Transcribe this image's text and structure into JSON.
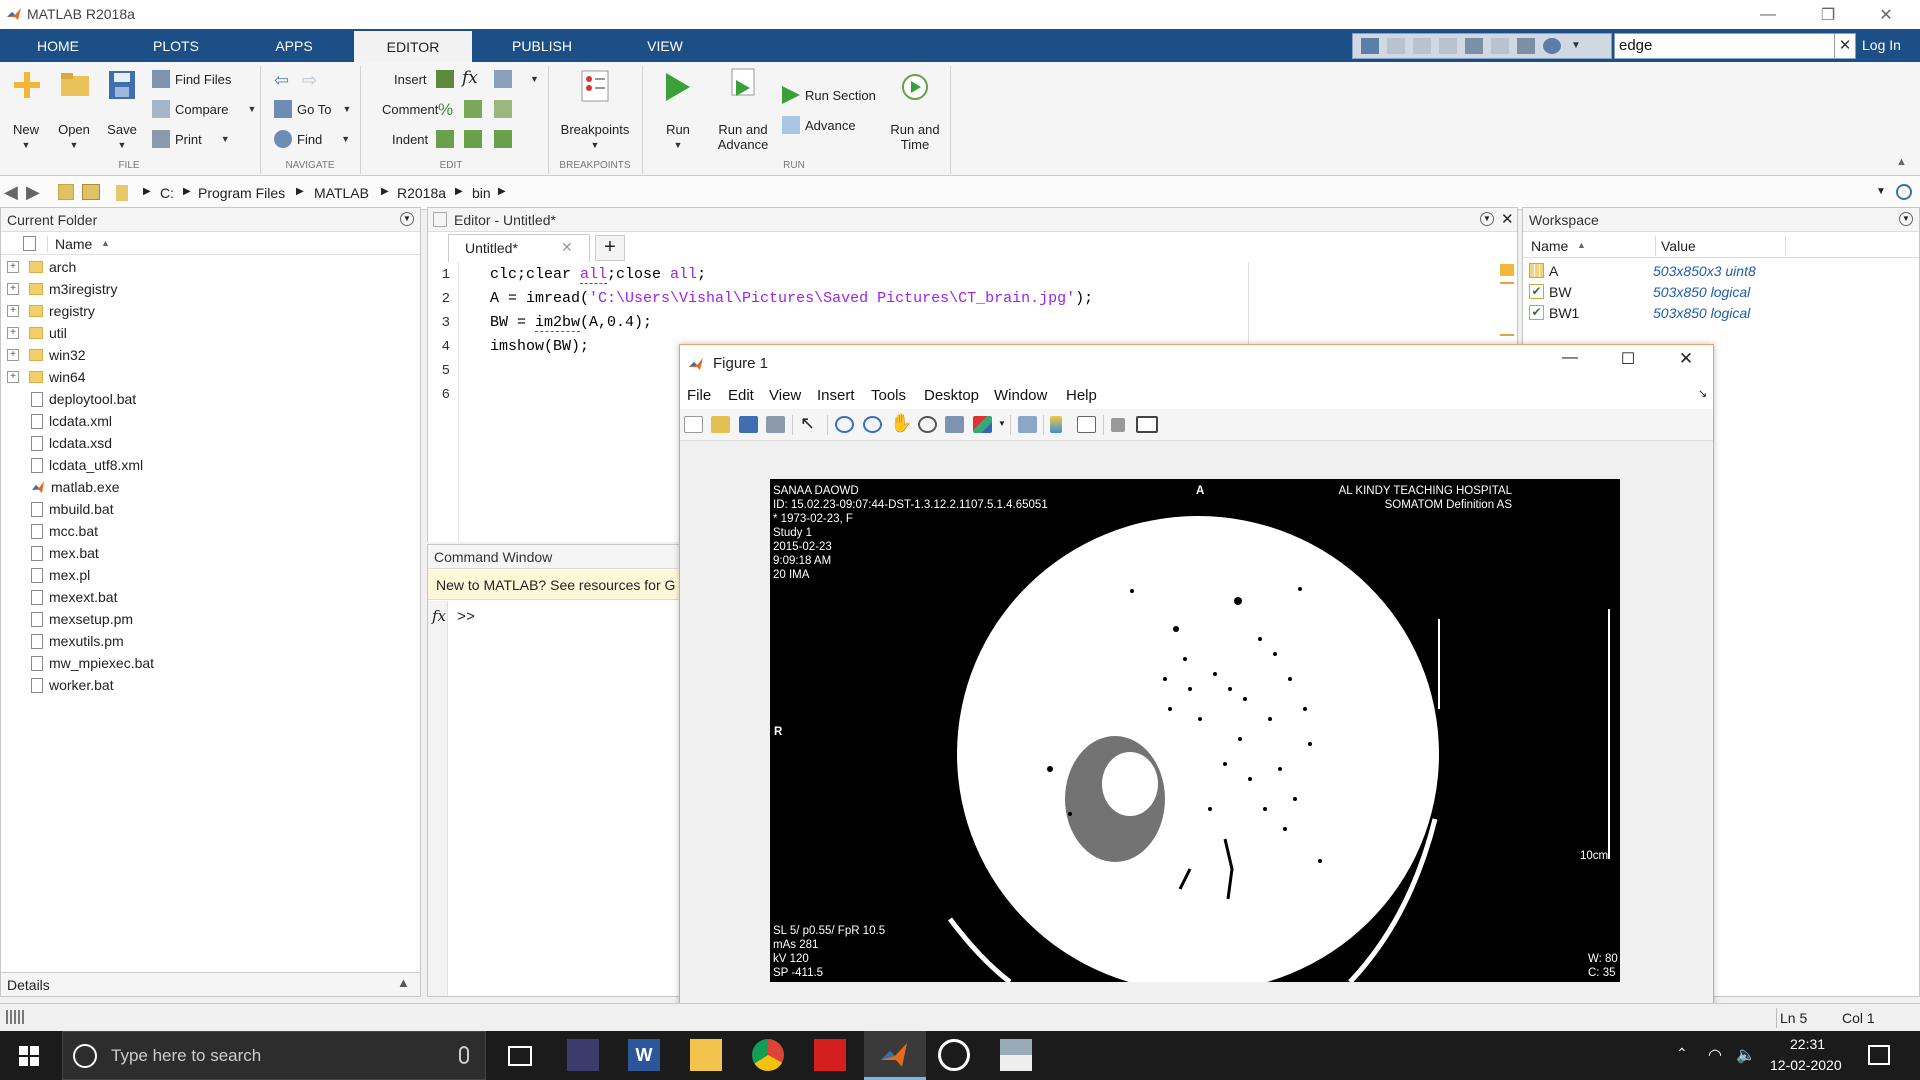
{
  "app": {
    "title": "MATLAB R2018a"
  },
  "tabs": [
    "HOME",
    "PLOTS",
    "APPS",
    "EDITOR",
    "PUBLISH",
    "VIEW"
  ],
  "search": {
    "value": "edge",
    "clear": "✕"
  },
  "login": "Log In",
  "ribbon": {
    "file": {
      "new": "New",
      "open": "Open",
      "save": "Save",
      "find_files": "Find Files",
      "compare": "Compare",
      "print": "Print",
      "label": "FILE"
    },
    "navigate": {
      "goto": "Go To",
      "find": "Find",
      "label": "NAVIGATE"
    },
    "edit": {
      "insert": "Insert",
      "comment": "Comment",
      "indent": "Indent",
      "label": "EDIT"
    },
    "breakpoints": {
      "button": "Breakpoints",
      "label": "BREAKPOINTS"
    },
    "run": {
      "run": "Run",
      "run_advance_1": "Run and",
      "run_advance_2": "Advance",
      "run_section": "Run Section",
      "advance": "Advance",
      "run_time_1": "Run and",
      "run_time_2": "Time",
      "label": "RUN"
    }
  },
  "address": {
    "crumbs": [
      "C:",
      "Program Files",
      "MATLAB",
      "R2018a",
      "bin"
    ]
  },
  "current_folder": {
    "title": "Current Folder",
    "name_header": "Name",
    "folders": [
      "arch",
      "m3iregistry",
      "registry",
      "util",
      "win32",
      "win64"
    ],
    "files": [
      "deploytool.bat",
      "lcdata.xml",
      "lcdata.xsd",
      "lcdata_utf8.xml",
      "matlab.exe",
      "mbuild.bat",
      "mcc.bat",
      "mex.bat",
      "mex.pl",
      "mexext.bat",
      "mexsetup.pm",
      "mexutils.pm",
      "mw_mpiexec.bat",
      "worker.bat"
    ],
    "details": "Details"
  },
  "editor": {
    "title": "Editor - Untitled*",
    "tab": "Untitled*",
    "line_numbers": [
      "1",
      "2",
      "3",
      "4",
      "5",
      "6"
    ],
    "lines": {
      "l1a": "clc;clear ",
      "l1b": "all",
      "l1c": ";close ",
      "l1d": "all",
      "l1e": ";",
      "l2a": "A = imread(",
      "l2b": "'C:\\Users\\Vishal\\Pictures\\Saved Pictures\\CT_brain.jpg'",
      "l2c": ");",
      "l3a": "BW = ",
      "l3b": "im2bw",
      "l3c": "(A,0.4);",
      "l4": "imshow(BW);"
    }
  },
  "command_window": {
    "title": "Command Window",
    "banner": "New to MATLAB? See resources for G",
    "prompt": ">>",
    "fx": "fx"
  },
  "figure": {
    "title": "Figure 1",
    "menu": [
      "File",
      "Edit",
      "View",
      "Insert",
      "Tools",
      "Desktop",
      "Window",
      "Help"
    ],
    "ct_text": {
      "top_left": "SANAA DAOWD\nID: 15.02.23-09:07:44-DST-1.3.12.2.1107.5.1.4.65051\n* 1973-02-23, F\nStudy 1\n2015-02-23\n9:09:18 AM\n20 IMA",
      "top_center": "A",
      "top_right": "AL KINDY TEACHING HOSPITAL\nSOMATOM Definition AS",
      "left_mid": "R",
      "scale": "10cm",
      "bottom_left": "SL 5/ p0.55/ FpR 10.5\nmAs 281\nkV 120\nSP -411.5",
      "bottom_right": "W: 80\nC: 35"
    }
  },
  "workspace": {
    "title": "Workspace",
    "headers": [
      "Name",
      "Value"
    ],
    "vars": [
      {
        "name": "A",
        "value": "503x850x3 uint8"
      },
      {
        "name": "BW",
        "value": "503x850 logical"
      },
      {
        "name": "BW1",
        "value": "503x850 logical"
      }
    ]
  },
  "status": {
    "ln": "Ln  5",
    "col": "Col  1"
  },
  "taskbar": {
    "search_placeholder": "Type here to search",
    "time": "22:31",
    "date": "12-02-2020"
  }
}
